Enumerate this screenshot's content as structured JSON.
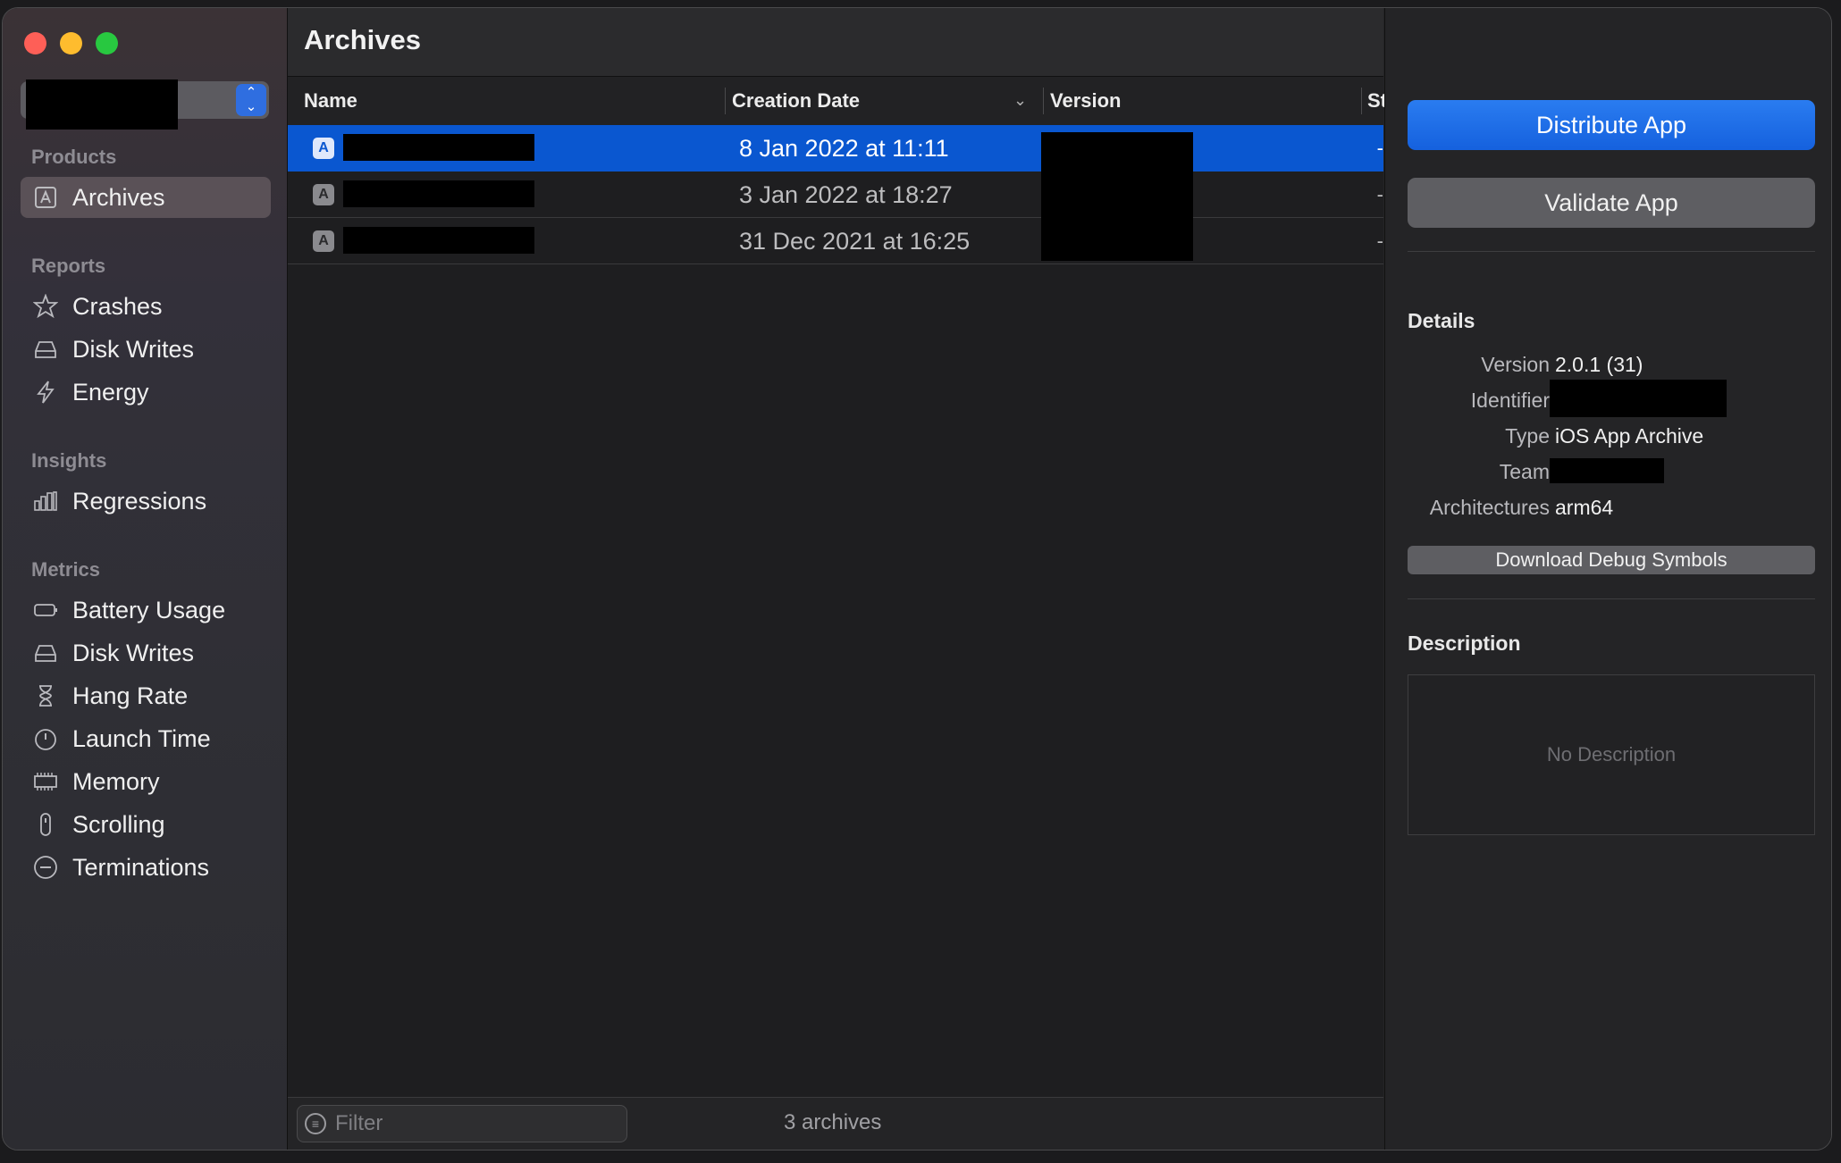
{
  "sidebar": {
    "sections": [
      {
        "heading": "Products",
        "items": [
          {
            "label": "Archives",
            "icon": "archive-icon",
            "selected": true
          }
        ]
      },
      {
        "heading": "Reports",
        "items": [
          {
            "label": "Crashes",
            "icon": "crash-icon"
          },
          {
            "label": "Disk Writes",
            "icon": "disk-icon"
          },
          {
            "label": "Energy",
            "icon": "bolt-icon"
          }
        ]
      },
      {
        "heading": "Insights",
        "items": [
          {
            "label": "Regressions",
            "icon": "bar-chart-icon"
          }
        ]
      },
      {
        "heading": "Metrics",
        "items": [
          {
            "label": "Battery Usage",
            "icon": "battery-icon"
          },
          {
            "label": "Disk Writes",
            "icon": "disk-icon"
          },
          {
            "label": "Hang Rate",
            "icon": "hourglass-icon"
          },
          {
            "label": "Launch Time",
            "icon": "timer-icon"
          },
          {
            "label": "Memory",
            "icon": "memory-chip-icon"
          },
          {
            "label": "Scrolling",
            "icon": "scroll-icon"
          },
          {
            "label": "Terminations",
            "icon": "minus-circle-icon"
          }
        ]
      }
    ]
  },
  "main": {
    "title": "Archives",
    "columns": {
      "name": "Name",
      "creation_date": "Creation Date",
      "version": "Version",
      "status": "St"
    },
    "rows": [
      {
        "date": "8 Jan 2022 at 11:11",
        "selected": true
      },
      {
        "date": "3 Jan 2022 at 18:27",
        "selected": false
      },
      {
        "date": "31 Dec 2021 at 16:25",
        "selected": false
      }
    ],
    "filter_placeholder": "Filter",
    "count_label": "3 archives"
  },
  "inspector": {
    "distribute_label": "Distribute App",
    "validate_label": "Validate App",
    "details_heading": "Details",
    "labels": {
      "version": "Version",
      "identifier": "Identifier",
      "type": "Type",
      "team": "Team",
      "architectures": "Architectures"
    },
    "values": {
      "version": "2.0.1 (31)",
      "type": "iOS App Archive",
      "architectures": "arm64"
    },
    "download_label": "Download Debug Symbols",
    "description_heading": "Description",
    "description_placeholder": "No Description"
  },
  "colors": {
    "selection": "#0a57d0",
    "accent": "#1561de",
    "close": "#fe5f57",
    "minimize": "#febc2e",
    "zoom": "#28c840"
  }
}
